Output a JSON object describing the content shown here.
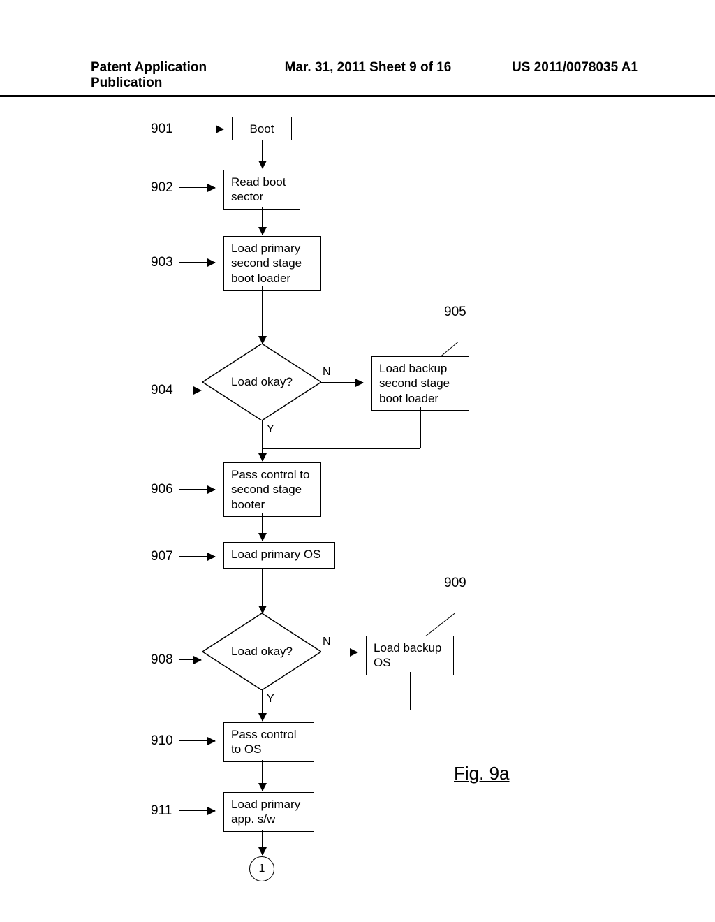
{
  "header": {
    "left": "Patent Application Publication",
    "mid": "Mar. 31, 2011  Sheet 9 of 16",
    "right": "US 2011/0078035 A1"
  },
  "figure_label": "Fig. 9a",
  "nodes": {
    "n901": {
      "ref": "901",
      "text": "Boot"
    },
    "n902": {
      "ref": "902",
      "text": "Read boot\nsector"
    },
    "n903": {
      "ref": "903",
      "text": "Load primary\nsecond stage\nboot loader"
    },
    "n904": {
      "ref": "904",
      "text": "Load okay?"
    },
    "n905": {
      "ref": "905",
      "text": "Load backup\nsecond stage\nboot loader"
    },
    "n906": {
      "ref": "906",
      "text": "Pass control to\nsecond stage\nbooter"
    },
    "n907": {
      "ref": "907",
      "text": "Load primary OS"
    },
    "n908": {
      "ref": "908",
      "text": "Load okay?"
    },
    "n909": {
      "ref": "909",
      "text": "Load backup\nOS"
    },
    "n910": {
      "ref": "910",
      "text": "Pass control\nto OS"
    },
    "n911": {
      "ref": "911",
      "text": "Load primary\napp. s/w"
    },
    "connector": {
      "text": "1"
    }
  },
  "edge_labels": {
    "yes": "Y",
    "no": "N"
  },
  "chart_data": {
    "type": "flowchart",
    "title": "Fig. 9a",
    "nodes": [
      {
        "id": "901",
        "kind": "terminator",
        "label": "Boot"
      },
      {
        "id": "902",
        "kind": "process",
        "label": "Read boot sector"
      },
      {
        "id": "903",
        "kind": "process",
        "label": "Load primary second stage boot loader"
      },
      {
        "id": "904",
        "kind": "decision",
        "label": "Load okay?"
      },
      {
        "id": "905",
        "kind": "process",
        "label": "Load backup second stage boot loader"
      },
      {
        "id": "906",
        "kind": "process",
        "label": "Pass control to second stage booter"
      },
      {
        "id": "907",
        "kind": "process",
        "label": "Load primary OS"
      },
      {
        "id": "908",
        "kind": "decision",
        "label": "Load okay?"
      },
      {
        "id": "909",
        "kind": "process",
        "label": "Load backup OS"
      },
      {
        "id": "910",
        "kind": "process",
        "label": "Pass control to OS"
      },
      {
        "id": "911",
        "kind": "process",
        "label": "Load primary app. s/w"
      },
      {
        "id": "C1",
        "kind": "offpage",
        "label": "1"
      }
    ],
    "edges": [
      {
        "from": "901",
        "to": "902"
      },
      {
        "from": "902",
        "to": "903"
      },
      {
        "from": "903",
        "to": "904"
      },
      {
        "from": "904",
        "to": "906",
        "label": "Y"
      },
      {
        "from": "904",
        "to": "905",
        "label": "N"
      },
      {
        "from": "905",
        "to": "906"
      },
      {
        "from": "906",
        "to": "907"
      },
      {
        "from": "907",
        "to": "908"
      },
      {
        "from": "908",
        "to": "910",
        "label": "Y"
      },
      {
        "from": "908",
        "to": "909",
        "label": "N"
      },
      {
        "from": "909",
        "to": "910"
      },
      {
        "from": "910",
        "to": "911"
      },
      {
        "from": "911",
        "to": "C1"
      }
    ]
  }
}
